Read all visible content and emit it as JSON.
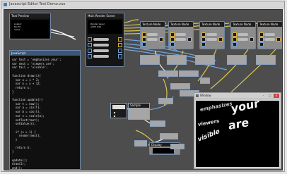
{
  "app": {
    "title": "Untitled Patch - Vuo Editor",
    "window_title_visible": "Javascript Editor Test Demo.vuo",
    "colors": {
      "canvas": "#4d4d4d",
      "wire_yellow": "#d8c64e",
      "wire_blue": "#72a7df",
      "wire_white": "#f0f0f0"
    }
  },
  "nodes": {
    "preview_left": {
      "title": "Text Preview",
      "mini_lines": [
        "scale 2",
        "fps 30",
        "value ..."
      ]
    },
    "preview_main": {
      "title": "Main Render Scene",
      "mini_lines": [
        "Render Layer",
        "width 640"
      ]
    },
    "grid_nodes": [
      {
        "title": "Texture Node"
      },
      {
        "title": "Texture Node"
      },
      {
        "title": "Texture Node"
      },
      {
        "title": "Texture Node"
      },
      {
        "title": "Texture Node"
      }
    ],
    "small_node": {
      "title": "Sample"
    },
    "bottom_node": {
      "title": "Display"
    }
  },
  "code_window": {
    "title": "JavaScript",
    "lines": [
      "var text = 'emphasizes your';",
      "var next = 'viewers are';",
      "var tail = 'visible';",
      "",
      "function draw(i){",
      "  var x = i * 3;",
      "  var y = x + 12;",
      "  return x;",
      "}",
      "",
      "function update(){",
      "  var t = now();",
      "  var a = sin(t);",
      "  var b = cos(t);",
      "  var s = scale(a);",
      "  setText(text);",
      "  setValue(s);",
      "",
      "  if (s > 1) {",
      "    render(next);",
      "  }",
      "",
      "  return b;",
      "}",
      "",
      "update();",
      "draw(2);",
      "end();",
      "// output"
    ]
  },
  "render_window": {
    "title": "Window",
    "controls": [
      "-",
      "□",
      "×"
    ],
    "text": {
      "line1": "emphasizes",
      "line2": "your",
      "line3": "viewers",
      "line4": "are",
      "line5": "visible"
    }
  }
}
